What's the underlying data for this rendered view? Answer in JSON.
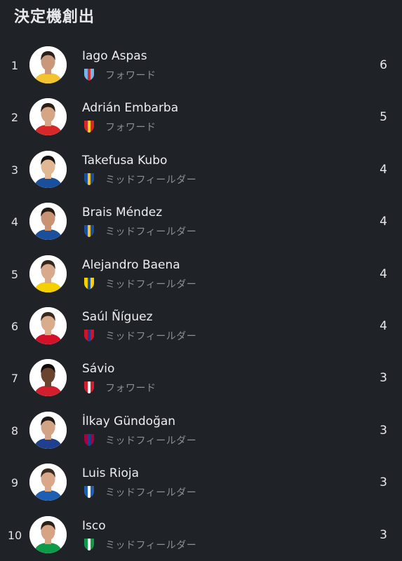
{
  "page": {
    "title": "決定機創出"
  },
  "players": [
    {
      "rank": "1",
      "name": "Iago Aspas",
      "position": "フォワード",
      "value": "6",
      "club_icon": "celta-vigo-crest-icon",
      "club_color": "#7ab4e6",
      "club_color2": "#d32f2f",
      "kit_color": "#f4c430",
      "skin": "#c9987a",
      "hair": "#2b1f18"
    },
    {
      "rank": "2",
      "name": "Adrián Embarba",
      "position": "フォワード",
      "value": "5",
      "club_icon": "almeria-crest-icon",
      "club_color": "#d62828",
      "club_color2": "#ffd21f",
      "kit_color": "#d62828",
      "skin": "#d6a585",
      "hair": "#2a1e17"
    },
    {
      "rank": "3",
      "name": "Takefusa Kubo",
      "position": "ミッドフィールダー",
      "value": "4",
      "club_icon": "real-sociedad-crest-icon",
      "club_color": "#1a4f9c",
      "club_color2": "#f2c230",
      "kit_color": "#1a4f9c",
      "skin": "#e0b894",
      "hair": "#15110e"
    },
    {
      "rank": "4",
      "name": "Brais Méndez",
      "position": "ミッドフィールダー",
      "value": "4",
      "club_icon": "real-sociedad-crest-icon",
      "club_color": "#1a4f9c",
      "club_color2": "#f2c230",
      "kit_color": "#1a4f9c",
      "skin": "#c99373",
      "hair": "#231a14"
    },
    {
      "rank": "5",
      "name": "Alejandro Baena",
      "position": "ミッドフィールダー",
      "value": "4",
      "club_icon": "villarreal-crest-icon",
      "club_color": "#f5d000",
      "club_color2": "#1b4f9b",
      "kit_color": "#f5d000",
      "skin": "#d8a98a",
      "hair": "#33261d"
    },
    {
      "rank": "6",
      "name": "Saúl Ñíguez",
      "position": "ミッドフィールダー",
      "value": "4",
      "club_icon": "atletico-madrid-crest-icon",
      "club_color": "#d3122a",
      "club_color2": "#1d3f8f",
      "kit_color": "#d3122a",
      "skin": "#d9ac8c",
      "hair": "#3a2a1e"
    },
    {
      "rank": "7",
      "name": "Sávio",
      "position": "フォワード",
      "value": "3",
      "club_icon": "girona-crest-icon",
      "club_color": "#d31f2d",
      "club_color2": "#ffffff",
      "kit_color": "#d31f2d",
      "skin": "#6b4430",
      "hair": "#120c09"
    },
    {
      "rank": "8",
      "name": "İlkay Gündoğan",
      "position": "ミッドフィールダー",
      "value": "3",
      "club_icon": "barcelona-crest-icon",
      "club_color": "#a50044",
      "club_color2": "#004d98",
      "kit_color": "#1f3f8f",
      "skin": "#d2a384",
      "hair": "#1e1713"
    },
    {
      "rank": "9",
      "name": "Luis Rioja",
      "position": "ミッドフィールダー",
      "value": "3",
      "club_icon": "alaves-crest-icon",
      "club_color": "#1e5fb4",
      "club_color2": "#ffffff",
      "kit_color": "#1e5fb4",
      "skin": "#d9a889",
      "hair": "#3b2b21"
    },
    {
      "rank": "10",
      "name": "Isco",
      "position": "ミッドフィールダー",
      "value": "3",
      "club_icon": "real-betis-crest-icon",
      "club_color": "#0f9a49",
      "club_color2": "#ffffff",
      "kit_color": "#0f9a49",
      "skin": "#d6a383",
      "hair": "#2c2018"
    }
  ]
}
